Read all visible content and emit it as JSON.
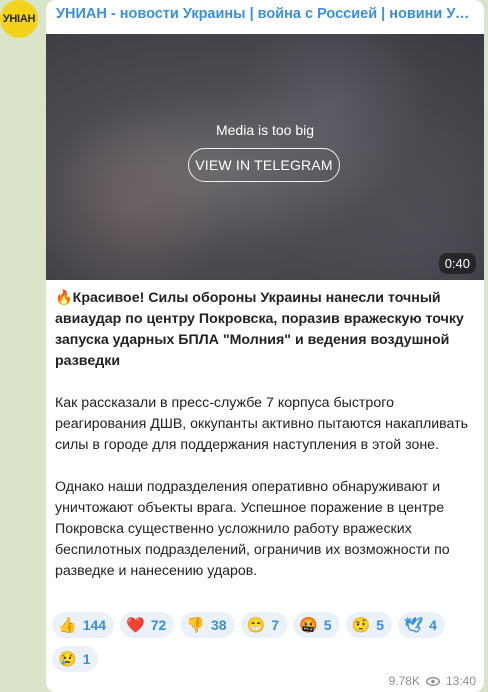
{
  "channel": {
    "title": "УНИАН - новости Украины | война с Россией | новини України | війна з Росією",
    "avatar_text": "УНІАН",
    "avatar_color": "#f3d21b"
  },
  "media": {
    "notice": "Media is too big",
    "button_label": "VIEW IN TELEGRAM",
    "duration": "0:40"
  },
  "post": {
    "headline_icon": "fire-icon",
    "headline_emoji": "🔥",
    "headline": "Красивое! Силы обороны Украины нанесли точный авиаудар по центру Покровска, поразив вражескую точку запуска ударных БПЛА \"Молния\" и ведения воздушной разведки",
    "paragraph1": "Как рассказали в пресс-службе 7 корпуса быстрого реагирования ДШВ, оккупанты активно пытаются накапливать силы в городе для поддержания наступления в этой зоне.",
    "paragraph2": "Однако наши подразделения оперативно обнаруживают и уничтожают объекты врага. Успешное поражение в центре Покровска существенно усложнило работу вражеских беспилотных подразделений, ограничив их возможности по разведке и нанесению ударов."
  },
  "reactions": [
    {
      "emoji": "👍",
      "icon": "thumbs-up-icon",
      "count": "144"
    },
    {
      "emoji": "❤️",
      "icon": "heart-icon",
      "count": "72"
    },
    {
      "emoji": "👎",
      "icon": "thumbs-down-icon",
      "count": "38"
    },
    {
      "emoji": "😁",
      "icon": "grin-icon",
      "count": "7"
    },
    {
      "emoji": "🤬",
      "icon": "angry-face-icon",
      "count": "5"
    },
    {
      "emoji": "🤨",
      "icon": "raised-eyebrow-icon",
      "count": "5"
    },
    {
      "emoji": "🕊",
      "icon": "dove-icon",
      "count": "4"
    },
    {
      "emoji": "😢",
      "icon": "crying-face-icon",
      "count": "1"
    }
  ],
  "meta": {
    "views": "9.78K",
    "views_icon": "eye-icon",
    "time": "13:40"
  },
  "colors": {
    "accent": "#3a8fd6",
    "background": "#d9e4c8"
  }
}
